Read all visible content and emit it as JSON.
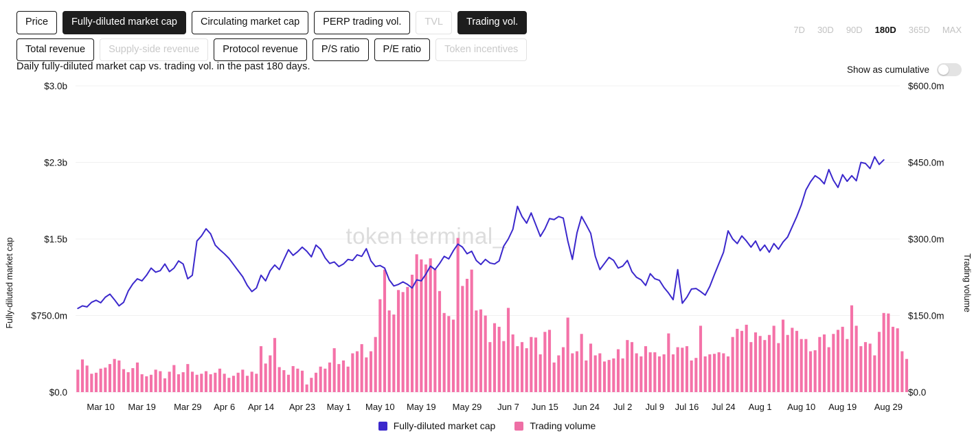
{
  "toolbar": {
    "row1": [
      {
        "label": "Price",
        "state": "normal"
      },
      {
        "label": "Fully-diluted market cap",
        "state": "active"
      },
      {
        "label": "Circulating market cap",
        "state": "normal"
      },
      {
        "label": "PERP trading vol.",
        "state": "normal"
      },
      {
        "label": "TVL",
        "state": "disabled"
      },
      {
        "label": "Trading vol.",
        "state": "active"
      }
    ],
    "row2": [
      {
        "label": "Total revenue",
        "state": "normal"
      },
      {
        "label": "Supply-side revenue",
        "state": "disabled"
      },
      {
        "label": "Protocol revenue",
        "state": "normal"
      },
      {
        "label": "P/S ratio",
        "state": "normal"
      },
      {
        "label": "P/E ratio",
        "state": "normal"
      },
      {
        "label": "Token incentives",
        "state": "disabled"
      }
    ]
  },
  "ranges": [
    {
      "label": "7D",
      "active": false
    },
    {
      "label": "30D",
      "active": false
    },
    {
      "label": "90D",
      "active": false
    },
    {
      "label": "180D",
      "active": true
    },
    {
      "label": "365D",
      "active": false
    },
    {
      "label": "MAX",
      "active": false
    }
  ],
  "subtitle": "Daily fully-diluted market cap vs. trading vol. in the past 180 days.",
  "cumulative": {
    "label": "Show as cumulative",
    "enabled": false
  },
  "watermark": "token terminal_",
  "legend": [
    {
      "label": "Fully-diluted market cap",
      "color": "#3B28CC"
    },
    {
      "label": "Trading volume",
      "color": "#EE6FA5"
    }
  ],
  "colors": {
    "line": "#3B28CC",
    "bar": "#F472A8",
    "grid": "#F0F0F0",
    "axis_text": "#111111",
    "watermark": "#DCDCDC",
    "toggle_track": "#E3E3E3"
  },
  "chart_data": {
    "type": "bar+line",
    "title": "Daily fully-diluted market cap vs. trading vol. in the past 180 days.",
    "xlabel": "",
    "ylabel": "Fully-diluted market cap",
    "y2label": "Trading volume",
    "ylim": [
      0,
      3000000000
    ],
    "y2lim": [
      0,
      600000000
    ],
    "grid": true,
    "legend_position": "bottom",
    "yticks": [
      "$0.0",
      "$750.0m",
      "$1.5b",
      "$2.3b",
      "$3.0b"
    ],
    "ytick_values": [
      0,
      750000000,
      1500000000,
      2250000000,
      3000000000
    ],
    "y2ticks": [
      "$0.0",
      "$150.0m",
      "$300.0m",
      "$450.0m",
      "$600.0m"
    ],
    "y2tick_values": [
      0,
      150000000,
      300000000,
      450000000,
      600000000
    ],
    "xticks": [
      "Mar 10",
      "Mar 19",
      "Mar 29",
      "Apr 6",
      "Apr 14",
      "Apr 23",
      "May 1",
      "May 10",
      "May 19",
      "May 29",
      "Jun 7",
      "Jun 15",
      "Jun 24",
      "Jul 2",
      "Jul 9",
      "Jul 16",
      "Jul 24",
      "Aug 1",
      "Aug 10",
      "Aug 19",
      "Aug 29"
    ],
    "xtick_indices": [
      5,
      14,
      24,
      32,
      40,
      49,
      57,
      66,
      75,
      85,
      94,
      102,
      111,
      119,
      126,
      133,
      141,
      149,
      158,
      167,
      177
    ],
    "n_points": 180,
    "series": [
      {
        "name": "Fully-diluted market cap",
        "type": "line",
        "axis": "left",
        "color": "#3B28CC",
        "units": "USD",
        "values": [
          820,
          845,
          835,
          880,
          900,
          875,
          930,
          960,
          905,
          845,
          880,
          990,
          1060,
          1110,
          1090,
          1145,
          1215,
          1175,
          1190,
          1255,
          1180,
          1215,
          1285,
          1255,
          1110,
          1145,
          1480,
          1530,
          1600,
          1550,
          1440,
          1395,
          1355,
          1310,
          1250,
          1190,
          1130,
          1045,
          985,
          1020,
          1145,
          1090,
          1190,
          1245,
          1200,
          1300,
          1395,
          1340,
          1375,
          1420,
          1380,
          1325,
          1440,
          1400,
          1315,
          1260,
          1275,
          1230,
          1255,
          1300,
          1290,
          1345,
          1330,
          1405,
          1285,
          1230,
          1240,
          1215,
          1100,
          1040,
          1055,
          1080,
          1055,
          1020,
          1100,
          1090,
          1155,
          1235,
          1200,
          1260,
          1330,
          1305,
          1385,
          1450,
          1420,
          1355,
          1380,
          1290,
          1250,
          1300,
          1265,
          1255,
          1285,
          1430,
          1500,
          1595,
          1820,
          1720,
          1655,
          1755,
          1640,
          1525,
          1600,
          1700,
          1690,
          1720,
          1705,
          1480,
          1300,
          1560,
          1720,
          1640,
          1555,
          1330,
          1200,
          1260,
          1320,
          1290,
          1215,
          1235,
          1290,
          1180,
          1125,
          1100,
          1045,
          1160,
          1110,
          1095,
          1025,
          970,
          905,
          1200,
          870,
          930,
          1010,
          1015,
          985,
          950,
          1035,
          1150,
          1260,
          1370,
          1580,
          1500,
          1455,
          1530,
          1480,
          1420,
          1480,
          1385,
          1440,
          1370,
          1455,
          1400,
          1470,
          1520,
          1620,
          1720,
          1835,
          1980,
          2060,
          2120,
          2090,
          2040,
          2180,
          2075,
          2005,
          2130,
          2065,
          2120,
          2070,
          2250,
          2240,
          2190,
          2305,
          2230,
          2275
        ]
      },
      {
        "name": "Trading volume",
        "type": "bar",
        "axis": "right",
        "color": "#F472A8",
        "units": "USD",
        "values": [
          44,
          64,
          52,
          36,
          38,
          46,
          48,
          55,
          65,
          62,
          45,
          39,
          47,
          58,
          35,
          31,
          34,
          44,
          41,
          27,
          40,
          53,
          35,
          39,
          55,
          40,
          34,
          36,
          41,
          35,
          38,
          46,
          36,
          28,
          32,
          38,
          44,
          32,
          40,
          36,
          90,
          56,
          72,
          106,
          49,
          43,
          34,
          51,
          46,
          42,
          15,
          28,
          38,
          50,
          46,
          58,
          86,
          55,
          62,
          50,
          76,
          80,
          94,
          68,
          80,
          108,
          182,
          240,
          160,
          152,
          200,
          196,
          206,
          230,
          270,
          260,
          250,
          262,
          240,
          198,
          155,
          149,
          142,
          302,
          208,
          222,
          240,
          160,
          162,
          150,
          98,
          135,
          128,
          100,
          165,
          113,
          90,
          98,
          86,
          108,
          107,
          74,
          118,
          122,
          58,
          72,
          88,
          146,
          76,
          80,
          114,
          62,
          95,
          72,
          76,
          60,
          63,
          66,
          84,
          66,
          102,
          98,
          76,
          70,
          90,
          78,
          78,
          70,
          74,
          115,
          74,
          88,
          87,
          90,
          62,
          67,
          130,
          70,
          74,
          75,
          78,
          76,
          70,
          108,
          124,
          120,
          132,
          98,
          117,
          110,
          102,
          112,
          130,
          96,
          142,
          112,
          126,
          120,
          104,
          104,
          80,
          82,
          108,
          113,
          88,
          114,
          122,
          128,
          104,
          170,
          130,
          90,
          98,
          95,
          72,
          118,
          155,
          154,
          128,
          125,
          80,
          65
        ]
      }
    ]
  }
}
